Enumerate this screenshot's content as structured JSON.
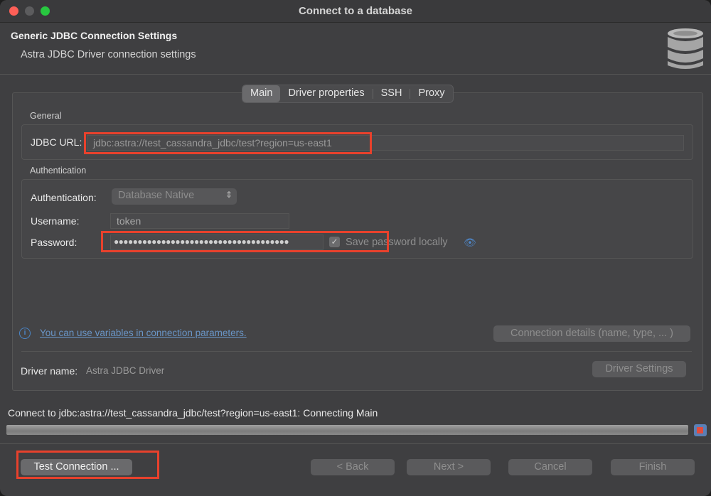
{
  "window": {
    "title": "Connect to a database"
  },
  "header": {
    "title": "Generic JDBC Connection Settings",
    "subtitle": "Astra JDBC Driver connection settings",
    "icon": "database-icon"
  },
  "tabs": [
    {
      "label": "Main",
      "active": true
    },
    {
      "label": "Driver properties",
      "active": false
    },
    {
      "label": "SSH",
      "active": false
    },
    {
      "label": "Proxy",
      "active": false
    }
  ],
  "general": {
    "group_label": "General",
    "jdbc_url_label": "JDBC URL:",
    "jdbc_url_value": "jdbc:astra://test_cassandra_jdbc/test?region=us-east1"
  },
  "auth": {
    "group_label": "Authentication",
    "auth_label": "Authentication:",
    "auth_value": "Database Native",
    "username_label": "Username:",
    "username_value": "token",
    "password_label": "Password:",
    "password_value": "●●●●●●●●●●●●●●●●●●●●●●●●●●●●●●●●●●●●●",
    "save_password_label": "Save password locally",
    "save_password_checked": true
  },
  "info": {
    "link_text": "You can use variables in connection parameters.",
    "details_button": "Connection details (name, type, ... )"
  },
  "driver": {
    "label": "Driver name:",
    "value": "Astra JDBC Driver",
    "settings_button": "Driver Settings"
  },
  "status": {
    "text": "Connect to jdbc:astra://test_cassandra_jdbc/test?region=us-east1: Connecting Main"
  },
  "buttons": {
    "test": "Test Connection ...",
    "back": "< Back",
    "next": "Next >",
    "cancel": "Cancel",
    "finish": "Finish"
  },
  "colors": {
    "highlight": "#e8412c",
    "accent": "#4a86c9",
    "background": "#3f3f41"
  }
}
